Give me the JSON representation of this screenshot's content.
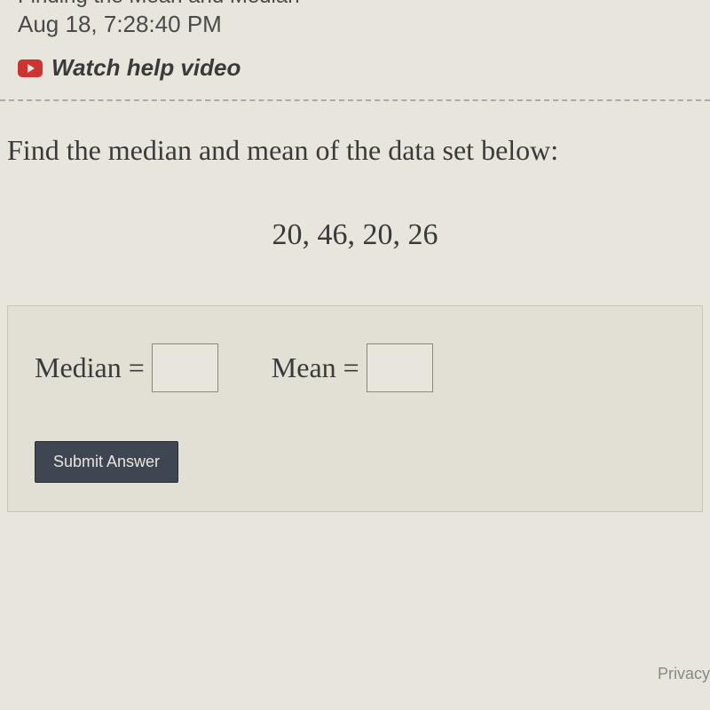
{
  "header": {
    "cut_title": "Finding the Mean and Median",
    "timestamp": "Aug 18, 7:28:40 PM",
    "video_link_text": "Watch help video"
  },
  "question": {
    "prompt": "Find the median and mean of the data set below:",
    "data_set": "20, 46, 20, 26"
  },
  "inputs": {
    "median_label": "Median =",
    "median_value": "",
    "mean_label": "Mean =",
    "mean_value": ""
  },
  "buttons": {
    "submit": "Submit Answer"
  },
  "footer": {
    "privacy": "Privacy"
  }
}
